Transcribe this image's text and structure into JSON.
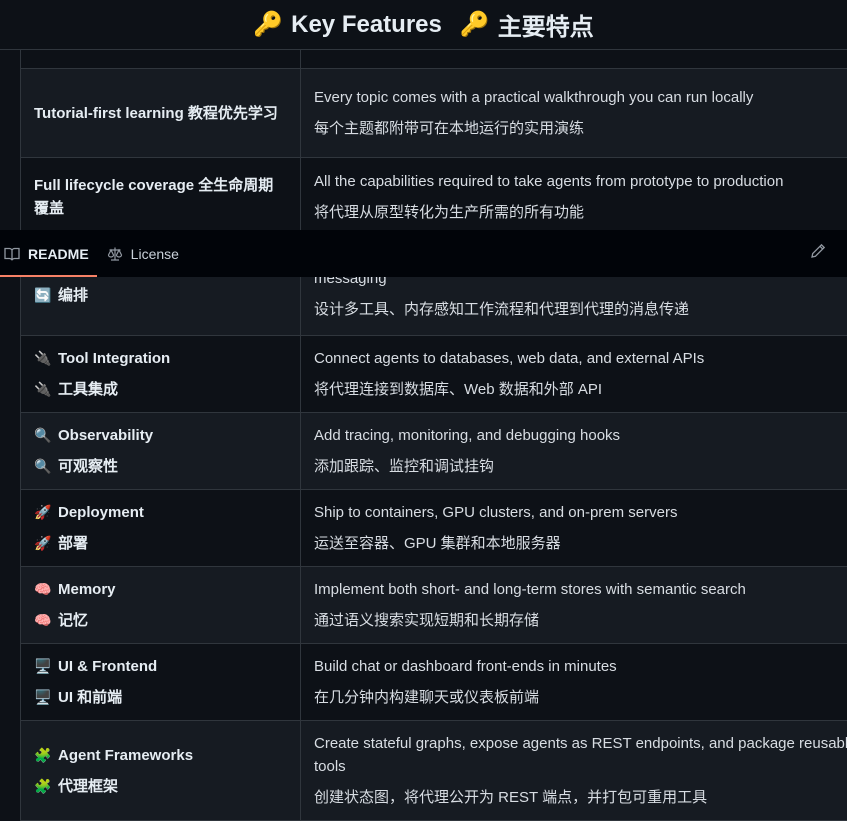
{
  "heading": {
    "icon": "key-icon",
    "title_en": "Key Features",
    "title_zh": "主要特点"
  },
  "tabs": [
    {
      "label": "README",
      "icon": "book-icon",
      "active": true
    },
    {
      "label": "License",
      "icon": "scale-icon",
      "active": false
    }
  ],
  "edit_icon": "pencil-icon",
  "rows": [
    {
      "feature": "",
      "desc": ""
    },
    {
      "feature": "Tutorial-first learning  教程优先学习",
      "desc_en": "Every topic comes with a practical walkthrough you can run locally",
      "desc_zh": "每个主题都附带可在本地运行的实用演练"
    },
    {
      "feature": "Full lifecycle coverage  全生命周期覆盖",
      "desc_en": "All the capabilities required to take agents from prototype to production",
      "desc_zh": "将代理从原型转化为生产所需的所有功能"
    },
    {
      "feature_en": "编排",
      "icon": "🔄",
      "desc_en": "messaging",
      "desc_zh": "设计多工具、内存感知工作流程和代理到代理的消息传递"
    },
    {
      "feature_en": "Tool Integration",
      "feature_zh": "工具集成",
      "icon": "🔌",
      "desc_en": "Connect agents to databases, web data, and external APIs",
      "desc_zh": "将代理连接到数据库、Web 数据和外部 API"
    },
    {
      "feature_en": "Observability",
      "feature_zh": "可观察性",
      "icon": "🔍",
      "desc_en": "Add tracing, monitoring, and debugging hooks",
      "desc_zh": "添加跟踪、监控和调试挂钩"
    },
    {
      "feature_en": "Deployment",
      "feature_zh": "部署",
      "icon": "🚀",
      "desc_en": "Ship to containers, GPU clusters, and on-prem servers",
      "desc_zh": "运送至容器、GPU 集群和本地服务器"
    },
    {
      "feature_en": "Memory",
      "feature_zh": "记忆",
      "icon": "🧠",
      "desc_en": "Implement both short- and long-term stores with semantic search",
      "desc_zh": "通过语义搜索实现短期和长期存储"
    },
    {
      "feature_en": "UI & Frontend",
      "feature_zh": "UI 和前端",
      "icon": "🖥️",
      "desc_en": "Build chat or dashboard front-ends in minutes",
      "desc_zh": "在几分钟内构建聊天或仪表板前端"
    },
    {
      "feature_en": "Agent Frameworks",
      "feature_zh": "代理框架",
      "icon": "🧩",
      "desc_en": "Create stateful graphs, expose agents as REST endpoints, and package reusable tools",
      "desc_zh": "创建状态图，将代理公开为 REST 端点，并打包可重用工具"
    }
  ]
}
